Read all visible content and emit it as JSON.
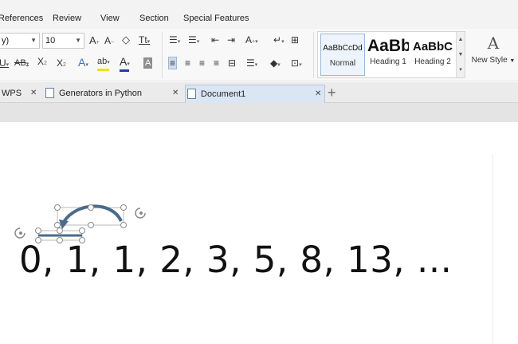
{
  "menu": {
    "items": [
      "References",
      "Review",
      "View",
      "Section",
      "Special Features"
    ]
  },
  "ribbon": {
    "font_name": "y)",
    "font_size": "10",
    "styles": [
      {
        "sample": "AaBbCcDd",
        "name": "Normal"
      },
      {
        "sample": "AaBb",
        "name": "Heading 1"
      },
      {
        "sample": "AaBbC",
        "name": "Heading 2"
      }
    ],
    "new_style_label": "New Style"
  },
  "tabs": {
    "items": [
      {
        "label": "WPS",
        "active": false
      },
      {
        "label": "Generators in Python",
        "active": false
      },
      {
        "label": "Document1",
        "active": true
      }
    ],
    "close_glyph": "✕",
    "add_glyph": "+"
  },
  "document": {
    "text": "0, 1, 1, 2, 3, 5, 8, 13, ..."
  },
  "colors": {
    "arrow": "#4a6b8a",
    "highlight_bar": "#f0e000",
    "font_color_bar": "#1f3fa8"
  }
}
